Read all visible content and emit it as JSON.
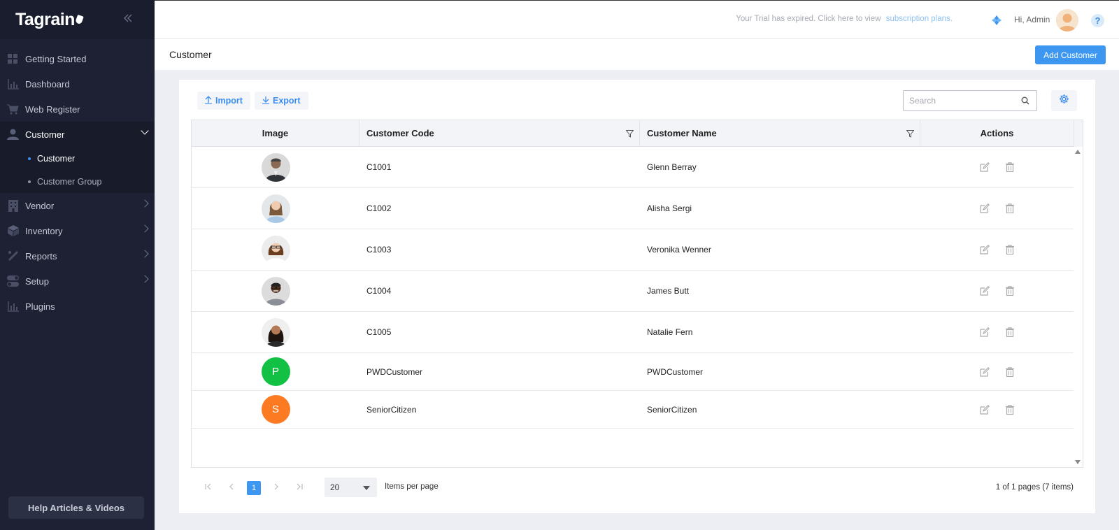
{
  "app": {
    "logo": "Tagrain"
  },
  "sidebar": {
    "items": [
      {
        "label": "Getting Started",
        "icon": "grid-icon"
      },
      {
        "label": "Dashboard",
        "icon": "bar-chart-icon"
      },
      {
        "label": "Web Register",
        "icon": "cart-icon"
      },
      {
        "label": "Customer",
        "icon": "user-icon"
      },
      {
        "label": "Vendor",
        "icon": "building-icon"
      },
      {
        "label": "Inventory",
        "icon": "box-icon"
      },
      {
        "label": "Reports",
        "icon": "ruler-icon"
      },
      {
        "label": "Setup",
        "icon": "toggle-icon"
      },
      {
        "label": "Plugins",
        "icon": "bar-chart-icon"
      }
    ],
    "customer_sub": [
      {
        "label": "Customer"
      },
      {
        "label": "Customer Group"
      }
    ],
    "help_label": "Help Articles & Videos"
  },
  "topbar": {
    "trial_text": "Your Trial has expired. Click here to view",
    "trial_link": "subscription plans.",
    "greeting": "Hi, Admin",
    "help_symbol": "?"
  },
  "page": {
    "title": "Customer",
    "add_button": "Add Customer"
  },
  "toolbar": {
    "import_label": "Import",
    "export_label": "Export",
    "search_placeholder": "Search"
  },
  "table": {
    "columns": [
      "Image",
      "Customer Code",
      "Customer Name",
      "Actions"
    ],
    "rows": [
      {
        "code": "C1001",
        "name": "Glenn Berray",
        "avatar": "photo"
      },
      {
        "code": "C1002",
        "name": "Alisha Sergi",
        "avatar": "photo"
      },
      {
        "code": "C1003",
        "name": "Veronika Wenner",
        "avatar": "photo"
      },
      {
        "code": "C1004",
        "name": "James Butt",
        "avatar": "photo"
      },
      {
        "code": "C1005",
        "name": "Natalie Fern",
        "avatar": "photo"
      },
      {
        "code": "PWDCustomer",
        "name": "PWDCustomer",
        "avatar": "letter",
        "letter": "P",
        "color": "#12c143"
      },
      {
        "code": "SeniorCitizen",
        "name": "SeniorCitizen",
        "avatar": "letter",
        "letter": "S",
        "color": "#fb7a22"
      }
    ]
  },
  "pager": {
    "current_page": "1",
    "page_size": "20",
    "items_per_page_label": "Items per page",
    "info": "1 of 1 pages (7 items)"
  },
  "colors": {
    "accent": "#3d96f0",
    "sidebar_bg": "#1e2133"
  }
}
